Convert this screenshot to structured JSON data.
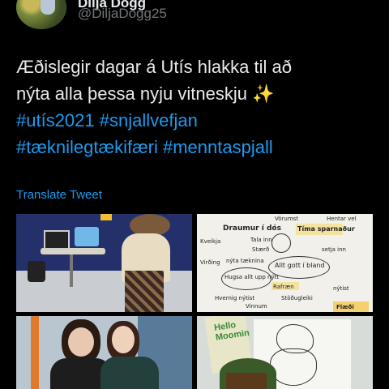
{
  "user": {
    "name": "Dilja Dogg",
    "handle": "@DiljaDogg25"
  },
  "tweet": {
    "text_line1": "Æðislegir dagar á Utís hlakka til að",
    "text_line2": "nýta alla þessa nyju vitneskju",
    "sparkle": "✨",
    "hashtags_line1": [
      "#utís2021",
      "#snjallvefjan"
    ],
    "hashtags_line2": [
      "#tæknilegtækifæri",
      "#menntaspjall"
    ]
  },
  "translate_label": "Translate Tweet",
  "photos": [
    {
      "icon": "photo-classroom"
    },
    {
      "icon": "photo-mindmap",
      "sketch_words": [
        "Draumur í dós",
        "Tíma sparnaður",
        "Tala inn",
        "Stærð",
        "Vörumst",
        "Hentar vel",
        "Kveikja",
        "Virðing",
        "nýta tæknina",
        "Allt gott í bland",
        "Hugsa allt upp nýtt",
        "Hvernig nýtist",
        "Vinnum",
        "Rafræn",
        "Flæði",
        "setja inn",
        "Stöðugleiki",
        "nýtist"
      ]
    },
    {
      "icon": "photo-two-women"
    },
    {
      "icon": "photo-moomin-book",
      "book_text": "Hello Moomin"
    }
  ]
}
